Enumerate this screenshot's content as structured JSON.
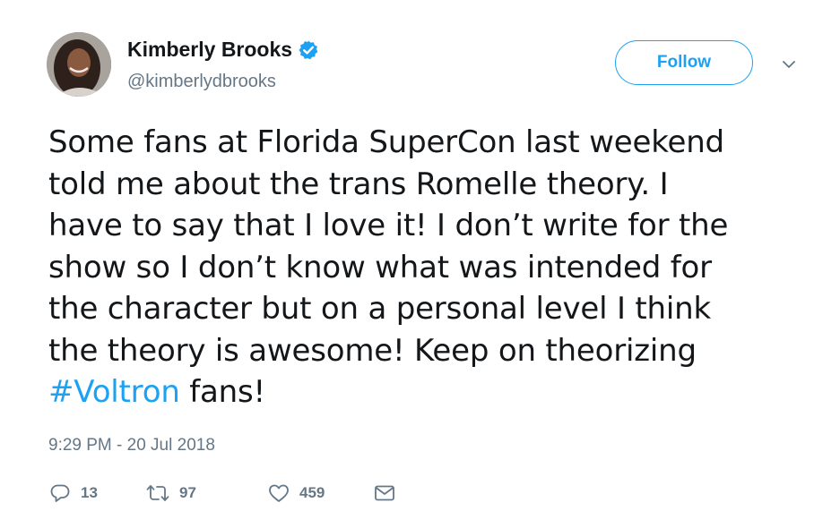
{
  "user": {
    "display_name": "Kimberly Brooks",
    "handle": "@kimberlydbrooks",
    "verified": true
  },
  "follow_button": {
    "label": "Follow"
  },
  "tweet": {
    "lines": [
      "Some fans at Florida SuperCon last weekend",
      "told me about the trans Romelle theory. I",
      "have to say that I love it! I don’t write for the",
      "show so I don’t know what was intended for",
      "the character but on a personal level I think",
      "the theory is awesome! Keep on theorizing"
    ],
    "hashtag": "#Voltron",
    "last_line_suffix": " fans!",
    "timestamp": "9:29 PM - 20 Jul 2018"
  },
  "actions": {
    "replies": "13",
    "retweets": "97",
    "likes": "459"
  },
  "colors": {
    "accent": "#1da1f2",
    "text": "#14171a",
    "secondary": "#657786"
  },
  "icons": [
    "verified-badge-icon",
    "chevron-down-icon",
    "reply-icon",
    "retweet-icon",
    "heart-icon",
    "envelope-icon"
  ]
}
